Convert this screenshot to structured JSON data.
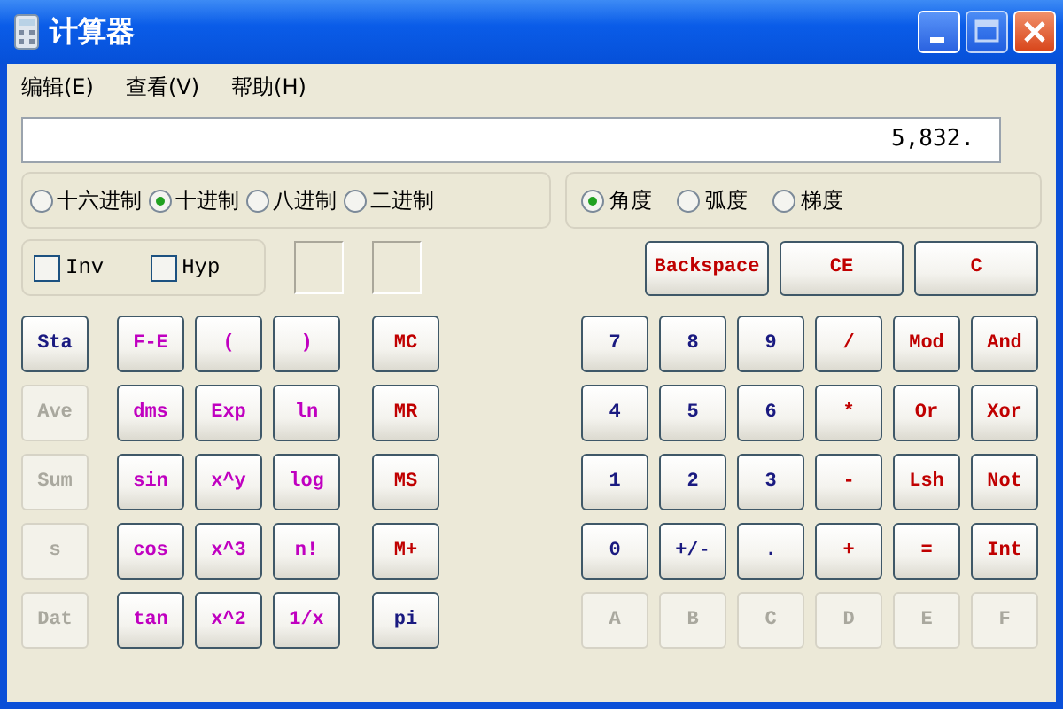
{
  "window": {
    "title": "计算器"
  },
  "menu": [
    {
      "label": "编辑(E)"
    },
    {
      "label": "查看(V)"
    },
    {
      "label": "帮助(H)"
    }
  ],
  "display": {
    "value": "5,832."
  },
  "bases": [
    {
      "label": "十六进制",
      "selected": false
    },
    {
      "label": "十进制",
      "selected": true
    },
    {
      "label": "八进制",
      "selected": false
    },
    {
      "label": "二进制",
      "selected": false
    }
  ],
  "angles": [
    {
      "label": "角度",
      "selected": true
    },
    {
      "label": "弧度",
      "selected": false
    },
    {
      "label": "梯度",
      "selected": false
    }
  ],
  "checkboxes": [
    {
      "label": "Inv",
      "checked": false
    },
    {
      "label": "Hyp",
      "checked": false
    }
  ],
  "top_buttons": [
    {
      "label": "Backspace",
      "color": "#c00000",
      "disabled": false
    },
    {
      "label": "CE",
      "color": "#c00000",
      "disabled": false
    },
    {
      "label": "C",
      "color": "#c00000",
      "disabled": false
    }
  ],
  "left_rows": [
    [
      {
        "label": "Sta",
        "color": "#1a1a80",
        "disabled": false
      },
      {
        "label": "F-E",
        "color": "#c000c0",
        "disabled": false
      },
      {
        "label": "(",
        "color": "#c000c0",
        "disabled": false
      },
      {
        "label": ")",
        "color": "#c000c0",
        "disabled": false
      },
      {
        "label": "MC",
        "color": "#c00000",
        "disabled": false
      }
    ],
    [
      {
        "label": "Ave",
        "disabled": true
      },
      {
        "label": "dms",
        "color": "#c000c0",
        "disabled": false
      },
      {
        "label": "Exp",
        "color": "#c000c0",
        "disabled": false
      },
      {
        "label": "ln",
        "color": "#c000c0",
        "disabled": false
      },
      {
        "label": "MR",
        "color": "#c00000",
        "disabled": false
      }
    ],
    [
      {
        "label": "Sum",
        "disabled": true
      },
      {
        "label": "sin",
        "color": "#c000c0",
        "disabled": false
      },
      {
        "label": "x^y",
        "color": "#c000c0",
        "disabled": false
      },
      {
        "label": "log",
        "color": "#c000c0",
        "disabled": false
      },
      {
        "label": "MS",
        "color": "#c00000",
        "disabled": false
      }
    ],
    [
      {
        "label": "s",
        "disabled": true
      },
      {
        "label": "cos",
        "color": "#c000c0",
        "disabled": false
      },
      {
        "label": "x^3",
        "color": "#c000c0",
        "disabled": false
      },
      {
        "label": "n!",
        "color": "#c000c0",
        "disabled": false
      },
      {
        "label": "M+",
        "color": "#c00000",
        "disabled": false
      }
    ],
    [
      {
        "label": "Dat",
        "disabled": true
      },
      {
        "label": "tan",
        "color": "#c000c0",
        "disabled": false
      },
      {
        "label": "x^2",
        "color": "#c000c0",
        "disabled": false
      },
      {
        "label": "1/x",
        "color": "#c000c0",
        "disabled": false
      },
      {
        "label": "pi",
        "color": "#1a1a80",
        "disabled": false
      }
    ]
  ],
  "right_rows": [
    [
      {
        "label": "7",
        "color": "#1a1a80",
        "disabled": false
      },
      {
        "label": "8",
        "color": "#1a1a80",
        "disabled": false
      },
      {
        "label": "9",
        "color": "#1a1a80",
        "disabled": false
      },
      {
        "label": "/",
        "color": "#c00000",
        "disabled": false
      },
      {
        "label": "Mod",
        "color": "#c00000",
        "disabled": false
      },
      {
        "label": "And",
        "color": "#c00000",
        "disabled": false
      }
    ],
    [
      {
        "label": "4",
        "color": "#1a1a80",
        "disabled": false
      },
      {
        "label": "5",
        "color": "#1a1a80",
        "disabled": false
      },
      {
        "label": "6",
        "color": "#1a1a80",
        "disabled": false
      },
      {
        "label": "*",
        "color": "#c00000",
        "disabled": false
      },
      {
        "label": "Or",
        "color": "#c00000",
        "disabled": false
      },
      {
        "label": "Xor",
        "color": "#c00000",
        "disabled": false
      }
    ],
    [
      {
        "label": "1",
        "color": "#1a1a80",
        "disabled": false
      },
      {
        "label": "2",
        "color": "#1a1a80",
        "disabled": false
      },
      {
        "label": "3",
        "color": "#1a1a80",
        "disabled": false
      },
      {
        "label": "-",
        "color": "#c00000",
        "disabled": false
      },
      {
        "label": "Lsh",
        "color": "#c00000",
        "disabled": false
      },
      {
        "label": "Not",
        "color": "#c00000",
        "disabled": false
      }
    ],
    [
      {
        "label": "0",
        "color": "#1a1a80",
        "disabled": false
      },
      {
        "label": "+/-",
        "color": "#1a1a80",
        "disabled": false
      },
      {
        "label": ".",
        "color": "#1a1a80",
        "disabled": false
      },
      {
        "label": "+",
        "color": "#c00000",
        "disabled": false
      },
      {
        "label": "=",
        "color": "#c00000",
        "disabled": false
      },
      {
        "label": "Int",
        "color": "#c00000",
        "disabled": false
      }
    ],
    [
      {
        "label": "A",
        "disabled": true
      },
      {
        "label": "B",
        "disabled": true
      },
      {
        "label": "C",
        "disabled": true
      },
      {
        "label": "D",
        "disabled": true
      },
      {
        "label": "E",
        "disabled": true
      },
      {
        "label": "F",
        "disabled": true
      }
    ]
  ]
}
